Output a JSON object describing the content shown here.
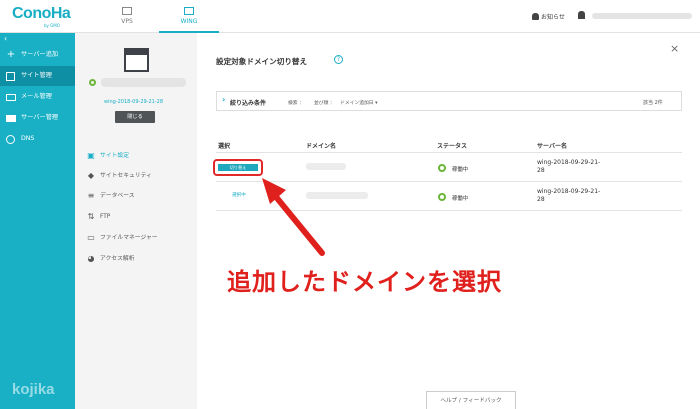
{
  "header": {
    "logo": "ConoHa",
    "logo_sub": "by GMO",
    "tabs": [
      {
        "label": "VPS"
      },
      {
        "label": "WING"
      }
    ],
    "notice_label": "お知らせ"
  },
  "sidebar": {
    "collapse_glyph": "‹",
    "items": [
      {
        "label": "サーバー追加"
      },
      {
        "label": "サイト管理"
      },
      {
        "label": "メール管理"
      },
      {
        "label": "サーバー管理"
      },
      {
        "label": "DNS"
      }
    ],
    "watermark": "kojika"
  },
  "site_panel": {
    "server_name": "wing-2018-09-29-21-28",
    "close_label": "閉じる",
    "menu": [
      {
        "label": "サイト設定"
      },
      {
        "label": "サイトセキュリティ"
      },
      {
        "label": "データベース"
      },
      {
        "label": "FTP"
      },
      {
        "label": "ファイルマネージャー"
      },
      {
        "label": "アクセス解析"
      }
    ]
  },
  "main": {
    "title": "設定対象ドメイン切り替え",
    "help_glyph": "?",
    "close_glyph": "×",
    "filter": {
      "label": "絞り込み条件",
      "search_label": "検索 ：",
      "sort_label": "並び順 ：",
      "sort_value": "ドメイン追加日 ▾",
      "count": "該当 2件"
    },
    "columns": {
      "select": "選択",
      "domain": "ドメイン名",
      "status": "ステータス",
      "server": "サーバー名"
    },
    "rows": [
      {
        "action": "切り替え",
        "status": "稼働中",
        "server": "wing-2018-09-29-21-28"
      },
      {
        "action": "選択中",
        "status": "稼働中",
        "server": "wing-2018-09-29-21-28"
      }
    ],
    "help_footer": "ヘルプ / フィードバック"
  },
  "annotation": {
    "text": "追加したドメインを選択",
    "color": "#e0201c"
  },
  "colors": {
    "brand": "#19b0c6",
    "brand_dark": "#0e8fa3",
    "status_ok": "#6ab53a",
    "highlight": "#e02a2a"
  }
}
